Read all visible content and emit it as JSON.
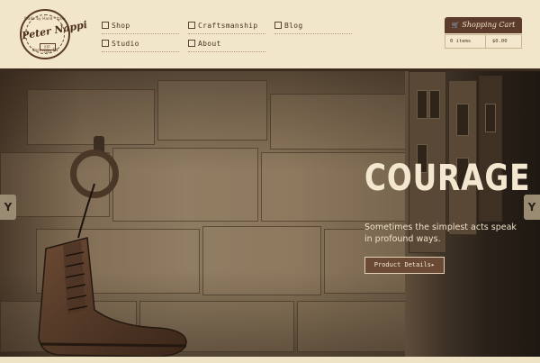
{
  "logo": {
    "script_text": "Peter Nappi",
    "ring_top": "Made by Hand · Italy",
    "ring_bottom": "Nashville, TN",
    "est": "EST. 2007"
  },
  "nav": {
    "items": [
      {
        "label": "Shop"
      },
      {
        "label": "Craftsmanship"
      },
      {
        "label": "Blog"
      },
      {
        "label": "Studio"
      },
      {
        "label": "About"
      }
    ]
  },
  "cart": {
    "button_label": "Shopping Cart",
    "icon": "cart-icon",
    "items_label": "0 items",
    "total_label": "$0.00"
  },
  "hero": {
    "title": "COURAGE",
    "subtitle": "Sometimes the simplest acts speak in profound ways.",
    "cta_label": "Product Details▸",
    "prev_arrow": "Y",
    "next_arrow": "Y"
  }
}
